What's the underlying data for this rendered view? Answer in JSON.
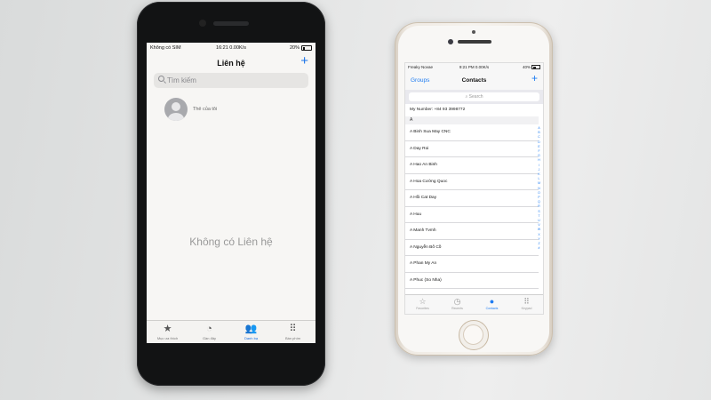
{
  "left_phone": {
    "status": {
      "carrier": "Không có SIM",
      "time": "16:21 0.00K/s",
      "battery": "20%",
      "battery_level": 0.2
    },
    "nav": {
      "title": "Liên hệ",
      "add_label": "+"
    },
    "search": {
      "placeholder": "Tìm kiếm"
    },
    "my_card": {
      "label": "Thẻ của tôi"
    },
    "empty_message": "Không có Liên hệ",
    "tabs": [
      {
        "label": "Mục ưa thích",
        "icon": "star-icon"
      },
      {
        "label": "Gần đây",
        "icon": "clock-icon"
      },
      {
        "label": "Danh bạ",
        "icon": "contacts-icon",
        "active": true
      },
      {
        "label": "Bàn phím",
        "icon": "keypad-icon"
      }
    ]
  },
  "right_phone": {
    "status": {
      "carrier": "Freaky Novae",
      "time": "9:21 PM 0.00K/s",
      "battery": "40%",
      "battery_level": 0.4
    },
    "nav": {
      "groups_label": "Groups",
      "title": "Contacts",
      "add_label": "+"
    },
    "search": {
      "placeholder": "Search"
    },
    "my_number": "My Number: +84 93 3998772",
    "section_header": "A",
    "contacts": [
      "A Binh Sua May CNC",
      "A Day Roi",
      "A Hao An Binh",
      "A Hoa Cường Quoc",
      "A Hồi Cat Day",
      "A Huu",
      "A Manh Tvmh",
      "A Nguyễn Bố Cồ",
      "A Phan My An",
      "A Phuc (So Nha)"
    ],
    "index_letters": [
      "A",
      "B",
      "C",
      "D",
      "E",
      "F",
      "G",
      "H",
      "I",
      "J",
      "K",
      "L",
      "M",
      "N",
      "O",
      "P",
      "Q",
      "R",
      "S",
      "T",
      "U",
      "V",
      "W",
      "X",
      "Y",
      "Z",
      "#"
    ],
    "tabs": [
      {
        "label": "Favorites",
        "icon": "star-icon"
      },
      {
        "label": "Recents",
        "icon": "clock-icon"
      },
      {
        "label": "Contacts",
        "icon": "contacts-icon",
        "active": true
      },
      {
        "label": "Keypad",
        "icon": "keypad-icon"
      }
    ]
  },
  "colors": {
    "ios_blue": "#1e7cf2",
    "black_phone_body": "#121314",
    "gold_phone_body": "#efeae3"
  }
}
